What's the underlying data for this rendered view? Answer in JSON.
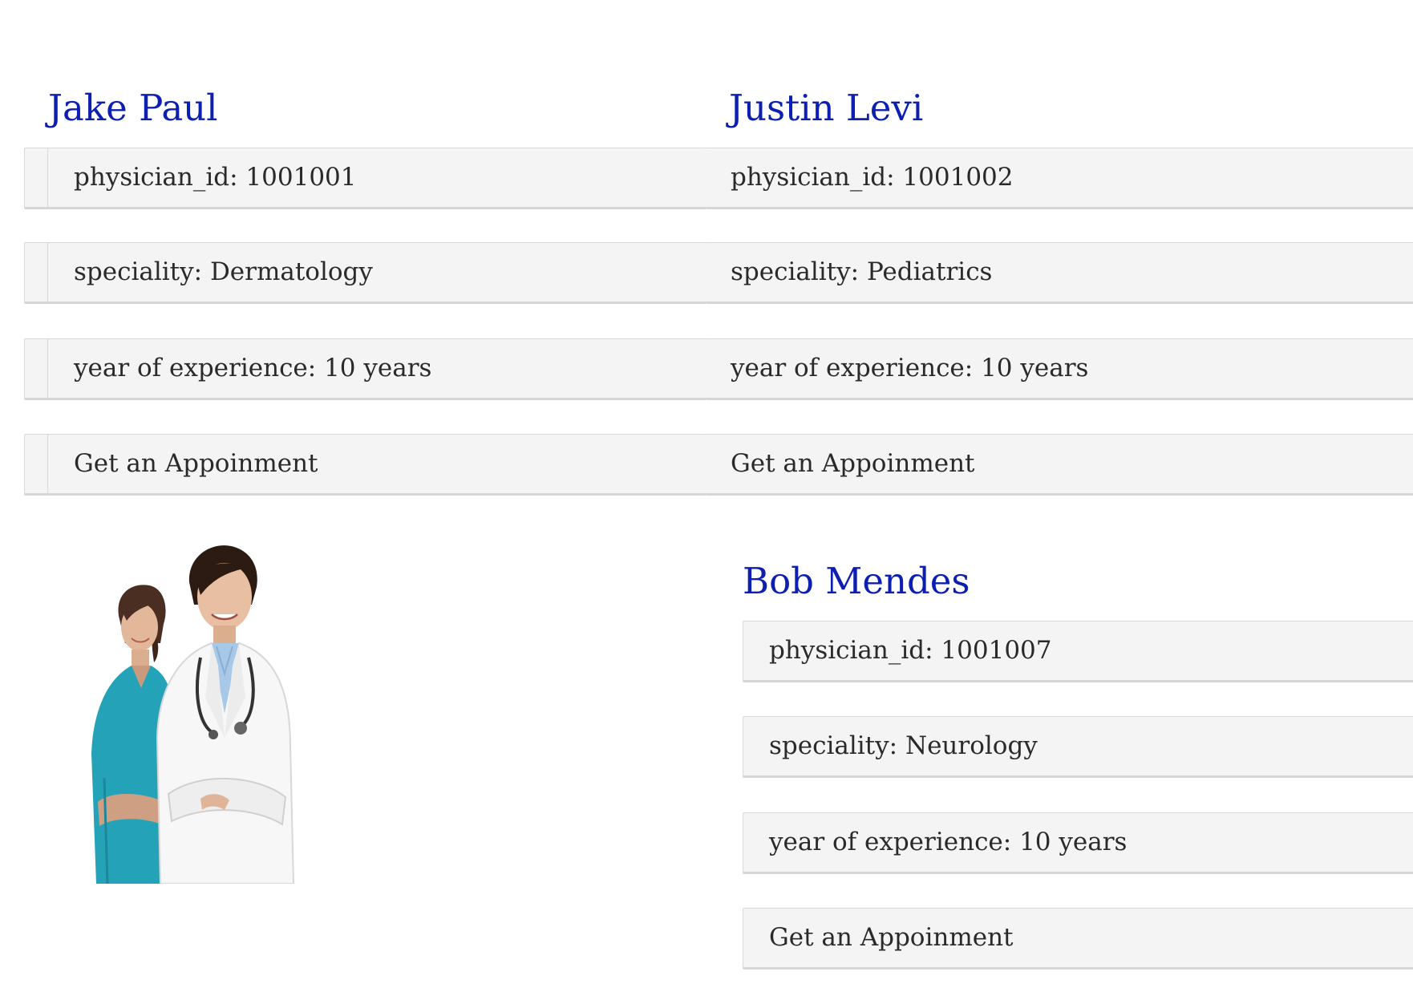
{
  "physicians": [
    {
      "name": "Jake Paul",
      "physician_id": "physician_id: 1001001",
      "speciality": "speciality: Dermatology",
      "experience": "year of experience: 10 years",
      "appointment_label": "Get an Appoinment"
    },
    {
      "name": "Justin Levi",
      "physician_id": "physician_id: 1001002",
      "speciality": "speciality: Pediatrics",
      "experience": "year of experience: 10 years",
      "appointment_label": "Get an Appoinment"
    },
    {
      "name": "Bob Mendes",
      "physician_id": "physician_id: 1001007",
      "speciality": "speciality: Neurology",
      "experience": "year of experience: 10 years",
      "appointment_label": "Get an Appoinment"
    }
  ],
  "image": {
    "subject": "doctors-photo"
  },
  "colors": {
    "name_heading": "#0c1fb0",
    "box_background": "#f4f4f4",
    "box_border": "#d9d9d9",
    "text": "#2a2a2a"
  }
}
